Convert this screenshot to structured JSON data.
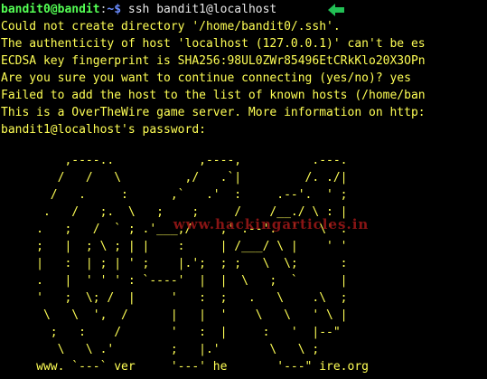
{
  "prompt": {
    "user_host": "bandit0@bandit",
    "separator": ":",
    "path_symbol": "~$",
    "command": " ssh bandit1@localhost"
  },
  "output_lines": [
    "Could not create directory '/home/bandit0/.ssh'.",
    "The authenticity of host 'localhost (127.0.0.1)' can't be es",
    "ECDSA key fingerprint is SHA256:98UL0ZWr85496EtCRkKlo20X3OPn",
    "Are you sure you want to continue connecting (yes/no)? yes",
    "Failed to add the host to the list of known hosts (/home/ban",
    "This is a OverTheWire game server. More information on http:",
    "bandit1@localhost's password:"
  ],
  "banner_lines": [
    "         ,----..            ,----,          .---.",
    "        /   /   \\         ,/   .`|         /. ./|",
    "       /   .     :      ,`   .'  :     .--'.  ' ;",
    "      .   /   ;.  \\   ;    ;     /    /__./ \\ : |",
    "     .   ;   /  ` ; .'___,/    ,' .--'.  '   \\' .",
    "     ;   |  ; \\ ; | |    :     | /___/ \\ |    ' '",
    "     |   :  | ; | ' ;    |.';  ; ;   \\  \\;      :",
    "     .   |  ' ' ' : `----'  |  |  \\   ;  `      |",
    "     '   ;  \\; /  |     '   :  ;   .   \\    .\\  ;",
    "      \\   \\  ',  /      |   |  '    \\   \\   ' \\ |",
    "       ;   :    /       '   :  |     :   '  |--\"",
    "        \\   \\ .'        ;   |.'       \\   \\ ;",
    "     www. `---` ver     '---' he       '---\" ire.org"
  ],
  "watermark": "www.hackingarticles.in",
  "colors": {
    "background": "#000000",
    "prompt_user": "#54ff54",
    "prompt_path": "#6a8cff",
    "text": "#ffff55",
    "arrow": "#22c055",
    "watermark": "#a01818"
  }
}
